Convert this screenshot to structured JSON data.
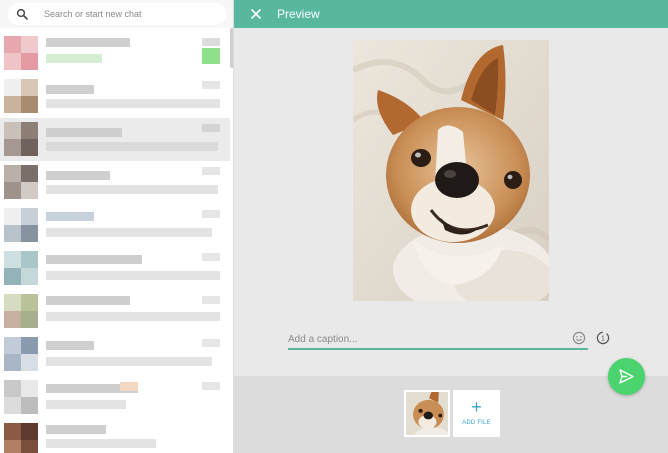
{
  "search": {
    "placeholder": "Search or start new chat"
  },
  "preview": {
    "title": "Preview",
    "caption_placeholder": "Add a caption...",
    "add_file_label": "ADD FILE",
    "add_file_symbol": "+"
  },
  "colors": {
    "accent": "#57b89d",
    "send": "#4bd46e",
    "link": "#3aa4cf"
  },
  "icons": [
    "search-icon",
    "close-icon",
    "emoji-icon",
    "timer-icon",
    "plus-icon",
    "send-icon"
  ]
}
